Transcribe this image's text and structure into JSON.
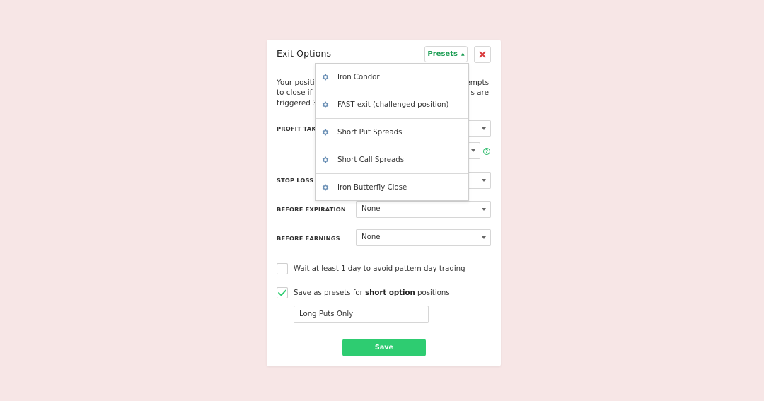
{
  "modal": {
    "title": "Exit Options",
    "presets_label": "Presets",
    "description_lines": [
      {
        "left": "Your position",
        "right": "empts"
      },
      {
        "left": "to close if an",
        "right": "s are"
      },
      {
        "left": "triggered 30",
        "right": ""
      }
    ],
    "rows": {
      "profit_taking": {
        "label": "PROFIT TAKIN"
      },
      "stop_loss": {
        "label": "STOP LOSS"
      },
      "before_expiration": {
        "label": "BEFORE EXPIRATION",
        "value": "None"
      },
      "before_earnings": {
        "label": "BEFORE EARNINGS",
        "value": "None"
      }
    },
    "help_glyph": "?",
    "checkboxes": {
      "wait_day": {
        "text": "Wait at least 1 day to avoid pattern day trading",
        "checked": false
      },
      "save_presets": {
        "text_before": "Save as presets for ",
        "text_bold": "short option",
        "text_after": " positions",
        "checked": true
      }
    },
    "preset_name_value": "Long Puts Only",
    "save_label": "Save"
  },
  "presets_menu": {
    "items": [
      {
        "label": "Iron Condor",
        "icon": "gear-icon"
      },
      {
        "label": "FAST exit (challenged position)",
        "icon": "gear-icon"
      },
      {
        "label": "Short Put Spreads",
        "icon": "gear-icon"
      },
      {
        "label": "Short Call Spreads",
        "icon": "gear-icon"
      },
      {
        "label": "Iron Butterfly Close",
        "icon": "gear-icon"
      }
    ]
  },
  "colors": {
    "background": "#f7e6e6",
    "accent_green": "#2ecc71",
    "close_red": "#d9383a",
    "gear_blue": "#6a8fb5"
  }
}
